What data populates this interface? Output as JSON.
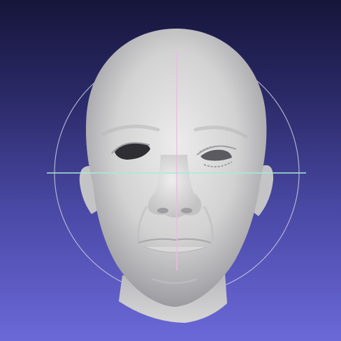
{
  "viewer": {
    "background_top": "#16153a",
    "background_bottom": "#6b69d8",
    "mesh_color": "#d4d4d4",
    "trackball_ring_color": "#c9c6de",
    "horizontal_axis_color": "#a8ead8",
    "vertical_axis_color": "#f0b7e6"
  }
}
